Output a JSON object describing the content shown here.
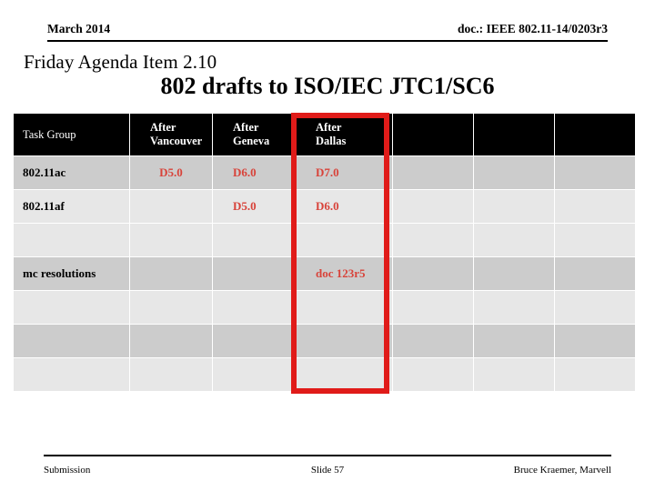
{
  "header": {
    "date": "March 2014",
    "doc_id": "doc.: IEEE 802.11-14/0203r3"
  },
  "titles": {
    "agenda_item": "Friday Agenda Item 2.10",
    "slide_title": "802  drafts to ISO/IEC JTC1/SC6"
  },
  "table": {
    "columns": [
      {
        "label": "Task Group"
      },
      {
        "label_line1": "After",
        "label_line2": "Vancouver"
      },
      {
        "label_line1": "After",
        "label_line2": "Geneva"
      },
      {
        "label_line1": "After",
        "label_line2": "Dallas"
      },
      {
        "label": ""
      },
      {
        "label": ""
      },
      {
        "label": ""
      }
    ],
    "rows": [
      {
        "shade": "dark",
        "cells": [
          "802.11ac",
          "D5.0",
          "D6.0",
          "D7.0",
          "",
          "",
          ""
        ]
      },
      {
        "shade": "light",
        "cells": [
          "802.11af",
          "",
          "D5.0",
          "D6.0",
          "",
          "",
          ""
        ]
      },
      {
        "shade": "light",
        "cells": [
          "",
          "",
          "",
          "",
          "",
          "",
          ""
        ]
      },
      {
        "shade": "dark",
        "cells": [
          "mc resolutions",
          "",
          "",
          "doc 123r5",
          "",
          "",
          ""
        ]
      },
      {
        "shade": "light",
        "cells": [
          "",
          "",
          "",
          "",
          "",
          "",
          ""
        ]
      },
      {
        "shade": "dark",
        "cells": [
          "",
          "",
          "",
          "",
          "",
          "",
          ""
        ]
      },
      {
        "shade": "light",
        "cells": [
          "",
          "",
          "",
          "",
          "",
          "",
          ""
        ]
      }
    ]
  },
  "highlight": {
    "name": "after-dallas-column-highlight",
    "color": "#e01b19"
  },
  "colors": {
    "header_cell_bg": "#000000",
    "header_cell_text": "#ffffff",
    "row_dark": "#cccccc",
    "row_light": "#e7e7e7",
    "value_text": "#d8433a",
    "highlight": "#e01b19"
  },
  "footer": {
    "left": "Submission",
    "center": "Slide 57",
    "right": "Bruce Kraemer, Marvell"
  }
}
